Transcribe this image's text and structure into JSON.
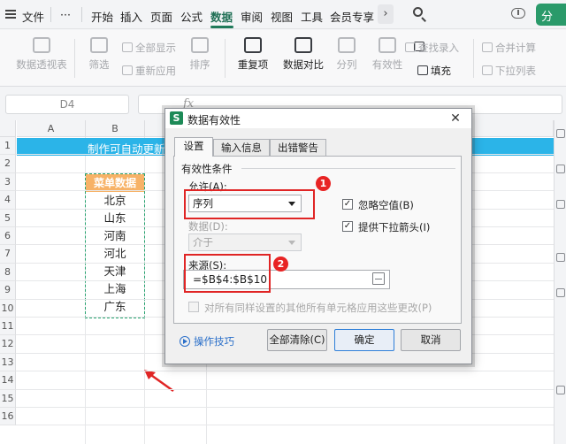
{
  "menubar": {
    "file": "文件",
    "more": "···",
    "tabs": [
      "开始",
      "插入",
      "页面",
      "公式",
      "数据",
      "审阅",
      "视图",
      "工具",
      "会员专享"
    ],
    "active_tab": "数据",
    "overflow": "›",
    "share_symbol": "分"
  },
  "ribbon": {
    "pivot": "数据透视表",
    "filter": "筛选",
    "show_all": "全部显示",
    "reapply": "重新应用",
    "sort": "排序",
    "duplicates": "重复项",
    "compare": "数据对比",
    "split": "分列",
    "validity": "有效性",
    "fill": "填充",
    "lookup_entry": "查找录入",
    "consolidate": "合并计算",
    "dropdown_list": "下拉列表"
  },
  "formula_bar": {
    "name_box": "D4",
    "fx": "fx"
  },
  "sheet": {
    "columns": [
      "A",
      "B"
    ],
    "rows": [
      "1",
      "2",
      "3",
      "4",
      "5",
      "6",
      "7",
      "8",
      "9",
      "10",
      "11",
      "12",
      "13",
      "14",
      "15",
      "16"
    ],
    "title": "制作可自动更新数",
    "list_header": "菜单数据",
    "list_items": [
      "北京",
      "山东",
      "河南",
      "河北",
      "天津",
      "上海",
      "广东"
    ]
  },
  "dialog": {
    "app_icon": "S",
    "title": "数据有效性",
    "close": "✕",
    "tabs": [
      "设置",
      "输入信息",
      "出错警告"
    ],
    "active_tab": "设置",
    "section_title": "有效性条件",
    "allow_label": "允许(A):",
    "allow_value": "序列",
    "data_label": "数据(D):",
    "data_value": "介于",
    "ignore_blank": "忽略空值(B)",
    "ignore_blank_checked": true,
    "dropdown_arrow": "提供下拉箭头(I)",
    "dropdown_arrow_checked": true,
    "source_label": "来源(S):",
    "source_value": "=$B$4:$B$10",
    "apply_all": "对所有同样设置的其他所有单元格应用这些更改(P)",
    "tips": "操作技巧",
    "clear_all": "全部清除(C)",
    "ok": "确定",
    "cancel": "取消",
    "badges": [
      "1",
      "2"
    ],
    "check_mark": "✓"
  },
  "colors": {
    "accent_green": "#1f7a5a",
    "title_blue": "#2bb4e8",
    "header_orange": "#f7b267",
    "annotation_red": "#e02525"
  }
}
